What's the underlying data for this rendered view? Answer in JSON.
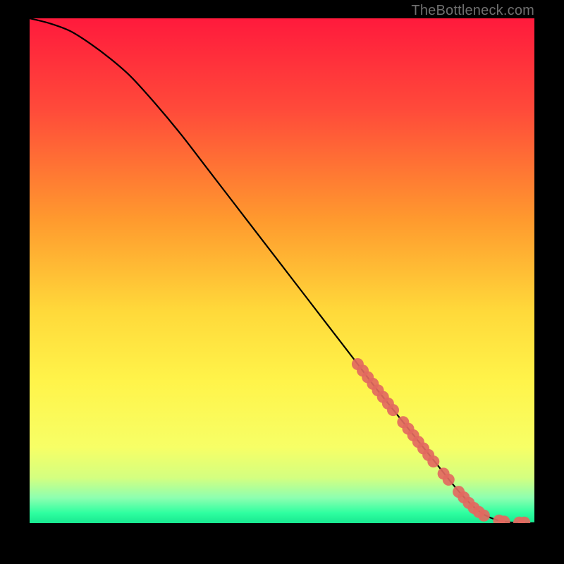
{
  "watermark": "TheBottleneck.com",
  "chart_data": {
    "type": "line",
    "title": "",
    "xlabel": "",
    "ylabel": "",
    "xlim": [
      0,
      100
    ],
    "ylim": [
      0,
      100
    ],
    "gradient_stops": [
      {
        "offset": 0,
        "color": "#ff1a3c"
      },
      {
        "offset": 18,
        "color": "#ff4a3a"
      },
      {
        "offset": 40,
        "color": "#ff9a2e"
      },
      {
        "offset": 58,
        "color": "#ffd93a"
      },
      {
        "offset": 72,
        "color": "#fff44a"
      },
      {
        "offset": 85,
        "color": "#f7ff66"
      },
      {
        "offset": 91,
        "color": "#d4ff80"
      },
      {
        "offset": 95,
        "color": "#8dffb0"
      },
      {
        "offset": 98,
        "color": "#2effa0"
      },
      {
        "offset": 100,
        "color": "#18e890"
      }
    ],
    "series": [
      {
        "name": "bottleneck-curve",
        "x": [
          0,
          4,
          8,
          12,
          16,
          20,
          25,
          30,
          35,
          40,
          45,
          50,
          55,
          60,
          65,
          68,
          72,
          76,
          80,
          82,
          84,
          86,
          88,
          90,
          92,
          94,
          96,
          98,
          100
        ],
        "y": [
          100,
          99,
          97.5,
          95,
          92,
          88.5,
          83,
          77,
          70.5,
          64,
          57.5,
          51,
          44.5,
          38,
          31.5,
          27.5,
          22.5,
          17.5,
          12.5,
          10,
          7.5,
          5.2,
          3.2,
          1.7,
          0.8,
          0.3,
          0.1,
          0.0,
          0.0
        ]
      }
    ],
    "markers": {
      "name": "data-points",
      "x": [
        65,
        66,
        67,
        68,
        69,
        70,
        71,
        72,
        74,
        75,
        76,
        77,
        78,
        79,
        80,
        82,
        83,
        85,
        86,
        87,
        88,
        89,
        90,
        93,
        94,
        97,
        98
      ],
      "y": [
        31.5,
        30.2,
        28.9,
        27.6,
        26.3,
        25.0,
        23.7,
        22.4,
        20.0,
        18.7,
        17.4,
        16.1,
        14.8,
        13.5,
        12.2,
        9.8,
        8.6,
        6.2,
        5.1,
        4.0,
        3.0,
        2.2,
        1.5,
        0.5,
        0.3,
        0.1,
        0.1
      ]
    }
  }
}
